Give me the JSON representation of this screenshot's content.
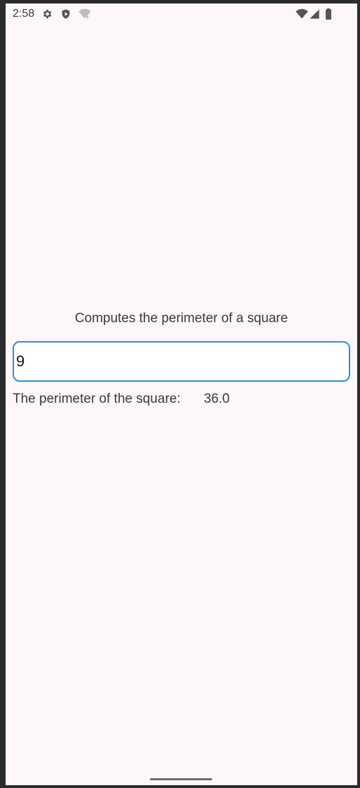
{
  "status_bar": {
    "time": "2:58",
    "icons": [
      "settings-gear-icon",
      "shield-icon",
      "wifi-question-icon",
      "wifi-signal-icon",
      "cell-signal-icon",
      "battery-icon"
    ]
  },
  "app": {
    "title": "Computes the perimeter of a square",
    "input_value": "9",
    "result_label": "The perimeter of the square:",
    "result_value": "36.0"
  },
  "colors": {
    "background": "#fdf6fb",
    "input_border": "#2f8fd6",
    "text": "#3a3a3a"
  }
}
